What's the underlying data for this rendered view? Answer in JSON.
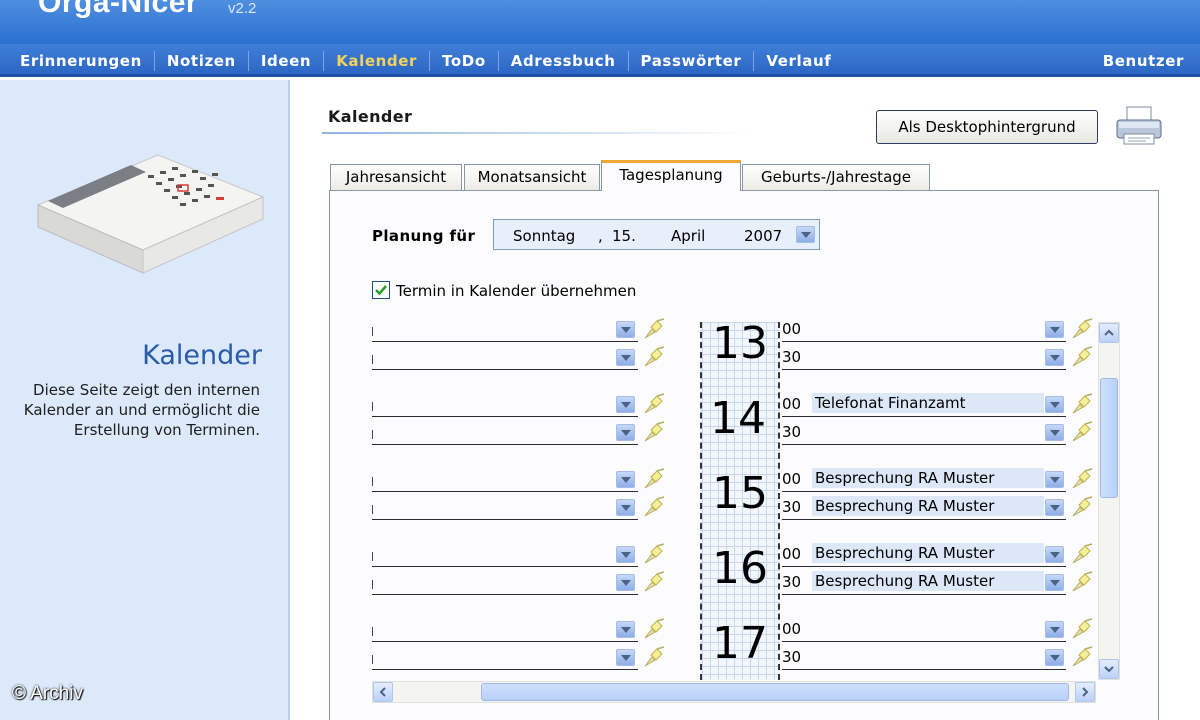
{
  "header": {
    "app_title": "Orga-Nicer",
    "version": "v2.2"
  },
  "menu": {
    "items": [
      "Erinnerungen",
      "Notizen",
      "Ideen",
      "Kalender",
      "ToDo",
      "Adressbuch",
      "Passwörter",
      "Verlauf"
    ],
    "active": "Kalender",
    "user": "Benutzer"
  },
  "sidebar": {
    "title": "Kalender",
    "description": "Diese Seite zeigt den internen Kalender an und ermöglicht die Erstellung von Terminen.",
    "watermark": "© Archiv",
    "icon": "calendar-icon"
  },
  "main": {
    "title": "Kalender",
    "desktop_button": "Als Desktophintergrund",
    "print_icon": "printer-icon"
  },
  "tabs": [
    {
      "label": "Jahresansicht",
      "active": false
    },
    {
      "label": "Monatsansicht",
      "active": false
    },
    {
      "label": "Tagesplanung",
      "active": true
    },
    {
      "label": "Geburts-/Jahrestage",
      "active": false
    }
  ],
  "planung": {
    "label": "Planung für",
    "weekday": "Sonntag",
    "separator": ",",
    "day": "15.",
    "month": "April",
    "year": "2007"
  },
  "checkbox": {
    "label": "Termin in Kalender übernehmen",
    "checked": true
  },
  "schedule": {
    "hours": [
      {
        "hour": "13",
        "slots": [
          {
            "minute": "00",
            "left": "",
            "right": ""
          },
          {
            "minute": "30",
            "left": "",
            "right": ""
          }
        ]
      },
      {
        "hour": "14",
        "slots": [
          {
            "minute": "00",
            "left": "",
            "right": "Telefonat Finanzamt"
          },
          {
            "minute": "30",
            "left": "",
            "right": ""
          }
        ]
      },
      {
        "hour": "15",
        "slots": [
          {
            "minute": "00",
            "left": "",
            "right": "Besprechung RA Muster"
          },
          {
            "minute": "30",
            "left": "",
            "right": "Besprechung RA Muster"
          }
        ]
      },
      {
        "hour": "16",
        "slots": [
          {
            "minute": "00",
            "left": "",
            "right": "Besprechung RA Muster"
          },
          {
            "minute": "30",
            "left": "",
            "right": "Besprechung RA Muster"
          }
        ]
      },
      {
        "hour": "17",
        "slots": [
          {
            "minute": "00",
            "left": "",
            "right": ""
          },
          {
            "minute": "30",
            "left": "",
            "right": ""
          }
        ]
      }
    ]
  },
  "colors": {
    "menu_bg": "#2d66c4",
    "active_menu": "#f2d35b",
    "sidebar_bg": "#dbe9fa",
    "active_tab_accent": "#f0a834",
    "filled_entry": "#dce8f8"
  }
}
